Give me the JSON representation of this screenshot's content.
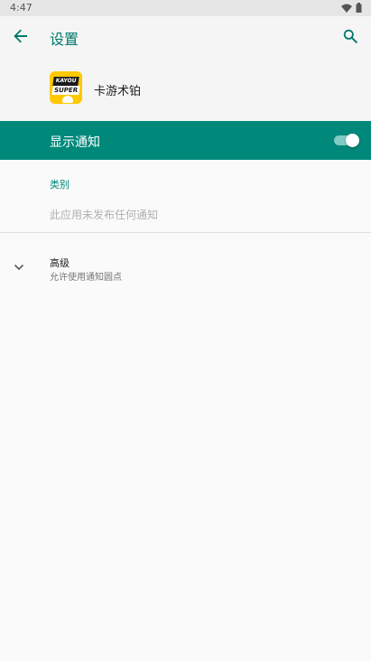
{
  "status_bar": {
    "time": "4:47",
    "icons": [
      "wifi-icon",
      "battery-icon"
    ]
  },
  "app_bar": {
    "back_icon": "arrow-back-icon",
    "title": "设置",
    "search_icon": "search-icon"
  },
  "app_header": {
    "app_icon": "kayou-super-logo",
    "app_name": "卡游术铂"
  },
  "main_toggle": {
    "label": "显示通知",
    "checked": true
  },
  "categories": {
    "header": "类别",
    "empty_text": "此应用未发布任何通知"
  },
  "advanced": {
    "expand_icon": "chevron-down-icon",
    "title": "高级",
    "summary": "允许使用通知圆点"
  },
  "colors": {
    "accent": "#00796b",
    "toggle_bar": "#00897b",
    "switch_track": "#80cbc4",
    "background": "#fafafa",
    "status_bar": "#e6e6e6"
  }
}
